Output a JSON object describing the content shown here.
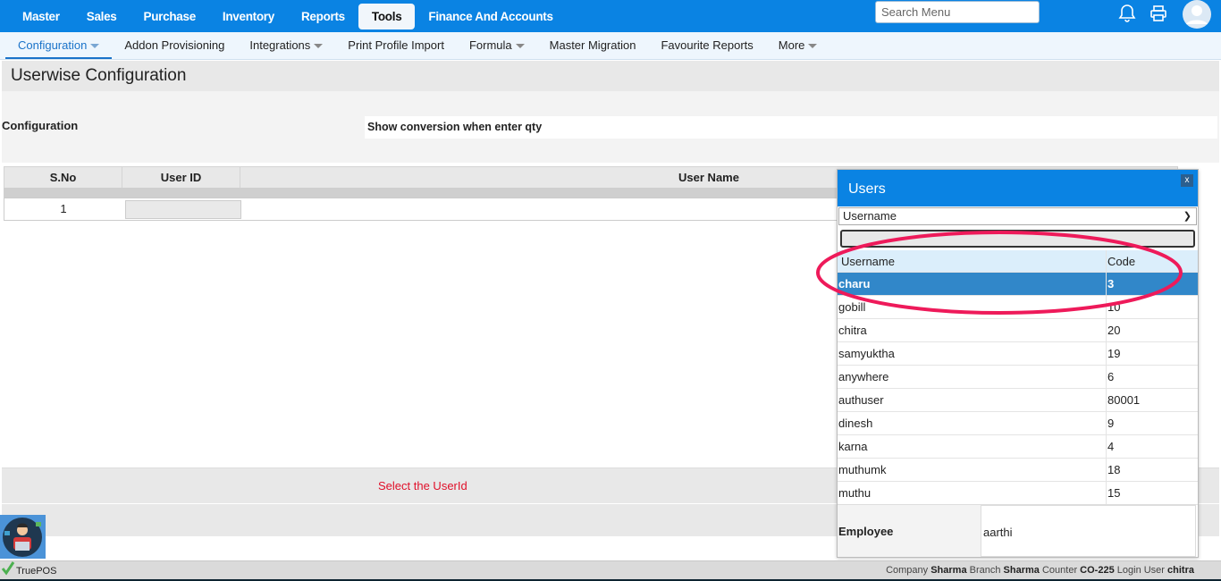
{
  "topnav": {
    "items": [
      "Master",
      "Sales",
      "Purchase",
      "Inventory",
      "Reports",
      "Tools",
      "Finance And Accounts"
    ],
    "active": "Tools",
    "search_placeholder": "Search Menu"
  },
  "subnav": {
    "items": [
      {
        "label": "Configuration",
        "caret": true
      },
      {
        "label": "Addon Provisioning"
      },
      {
        "label": "Integrations",
        "caret": true
      },
      {
        "label": "Print Profile Import"
      },
      {
        "label": "Formula",
        "caret": true
      },
      {
        "label": "Master Migration"
      },
      {
        "label": "Favourite Reports"
      },
      {
        "label": "More",
        "caret": true
      }
    ]
  },
  "page": {
    "title": "Userwise Configuration",
    "config_label": "Configuration",
    "config_value": "Show conversion when enter qty"
  },
  "table": {
    "headers": [
      "S.No",
      "User ID",
      "User Name"
    ],
    "rows": [
      {
        "sno": "1"
      }
    ]
  },
  "message": "Select the UserId",
  "popup": {
    "title": "Users",
    "close": "x",
    "filter_select": "Username",
    "columns": [
      "Username",
      "Code"
    ],
    "rows": [
      {
        "name": "charu",
        "code": "3"
      },
      {
        "name": "gobill",
        "code": "10"
      },
      {
        "name": "chitra",
        "code": "20"
      },
      {
        "name": "samyuktha",
        "code": "19"
      },
      {
        "name": "anywhere",
        "code": "6"
      },
      {
        "name": "authuser",
        "code": "80001"
      },
      {
        "name": "dinesh",
        "code": "9"
      },
      {
        "name": "karna",
        "code": "4"
      },
      {
        "name": "muthumk",
        "code": "18"
      },
      {
        "name": "muthu",
        "code": "15"
      }
    ],
    "selected_index": 0,
    "employee_label": "Employee",
    "employee_value": "aarthi"
  },
  "status": {
    "brand": "TruePOS",
    "company_label": "Company",
    "company": "Sharma",
    "branch_label": "Branch",
    "branch": "Sharma",
    "counter_label": "Counter",
    "counter": "CO-225",
    "login_label": "Login User",
    "login": "chitra"
  },
  "colors": {
    "brand": "#0a83e3",
    "selected": "#3187c9",
    "annotation": "#ee1a5a"
  }
}
